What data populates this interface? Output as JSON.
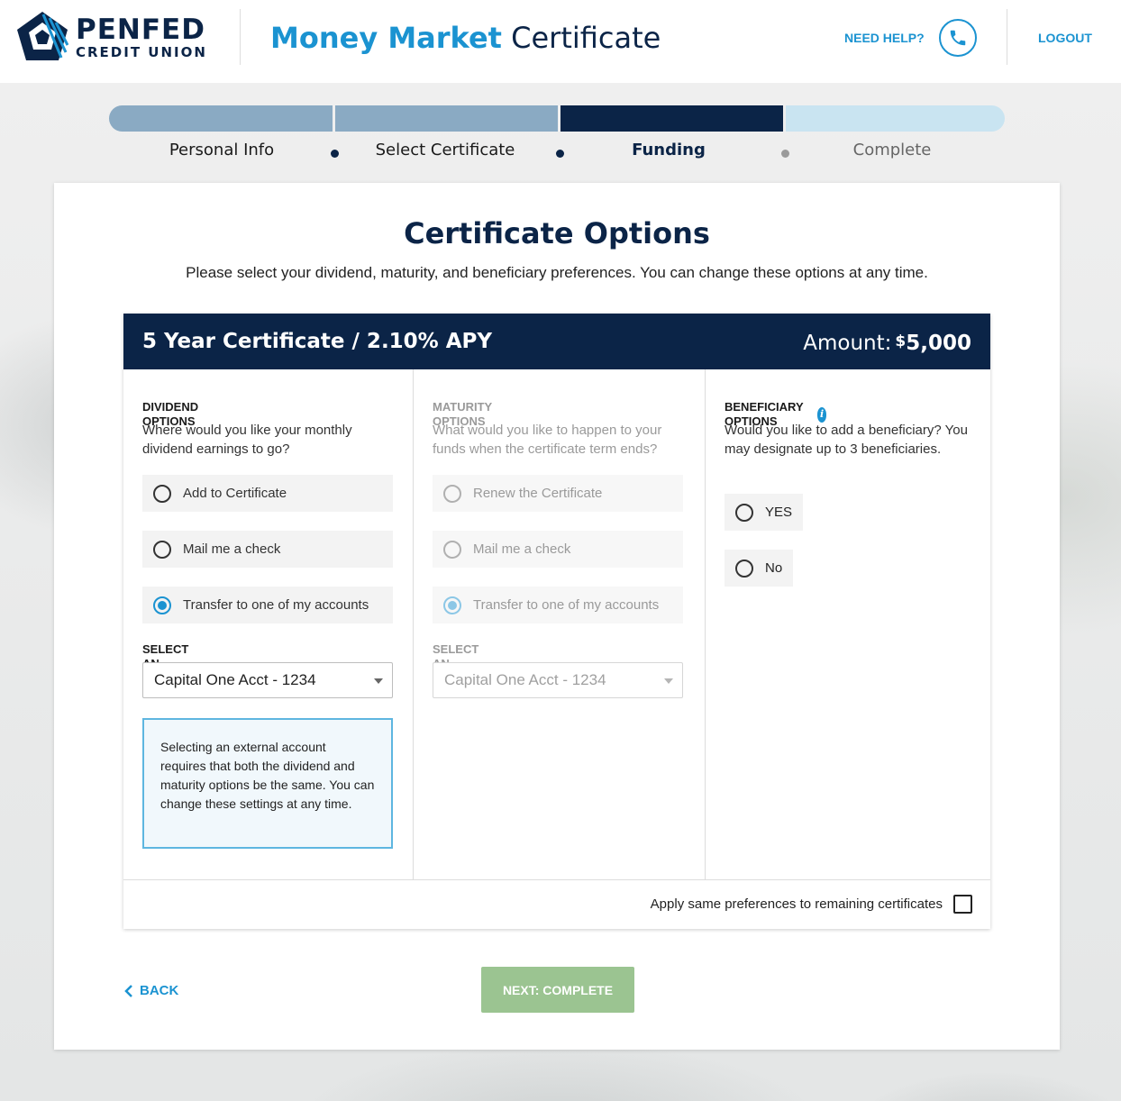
{
  "header": {
    "logo_top": "PENFED",
    "logo_bottom": "CREDIT UNION",
    "title_strong": "Money Market",
    "title_light": "Certificate",
    "need_help": "NEED HELP?",
    "logout": "LOGOUT"
  },
  "progress": {
    "steps": [
      {
        "label": "Personal Info",
        "state": "complete"
      },
      {
        "label": "Select Certificate",
        "state": "complete"
      },
      {
        "label": "Funding",
        "state": "current"
      },
      {
        "label": "Complete",
        "state": "upcoming"
      }
    ]
  },
  "card": {
    "title": "Certificate Options",
    "subtitle": "Please select your dividend, maturity, and beneficiary preferences. You can change these options at any time."
  },
  "certificate": {
    "title": "5 Year Certificate / 2.10% APY",
    "amount_label": "Amount:",
    "currency": "$",
    "amount": "5,000"
  },
  "dividend": {
    "heading": "DIVIDEND OPTIONS",
    "description": "Where would you like your monthly dividend earnings to go?",
    "options": [
      {
        "label": "Add to Certificate",
        "checked": false
      },
      {
        "label": "Mail me a check",
        "checked": false
      },
      {
        "label": "Transfer to one of my accounts",
        "checked": true
      }
    ],
    "select_label": "SELECT AN ACCOUNT",
    "select_value": "Capital One Acct - 1234",
    "info": "Selecting an external account requires that both the dividend and maturity options be the same. You can change these settings at any time."
  },
  "maturity": {
    "heading": "MATURITY OPTIONS",
    "description": "What would you like to happen to your funds when the certificate term ends?",
    "options": [
      {
        "label": "Renew the Certificate",
        "checked": false
      },
      {
        "label": "Mail me a check",
        "checked": false
      },
      {
        "label": "Transfer to one of my accounts",
        "checked": true
      }
    ],
    "select_label": "SELECT AN ACCOUNT",
    "select_value": "Capital One Acct - 1234"
  },
  "beneficiary": {
    "heading": "BENEFICIARY OPTIONS",
    "description": "Would you like to add a beneficiary? You may designate up to 3 beneficiaries.",
    "options": [
      {
        "label": "YES",
        "checked": false
      },
      {
        "label": "No",
        "checked": false
      }
    ]
  },
  "apply_same": {
    "label": "Apply same preferences to remaining certificates",
    "checked": false
  },
  "nav": {
    "back": "BACK",
    "next": "NEXT: COMPLETE"
  },
  "colors": {
    "brand_navy": "#0b2447",
    "brand_blue": "#1b93d1",
    "next_button": "#9bc491",
    "progress_done": "#8aaac3",
    "progress_upcoming": "#c9e4f1"
  }
}
